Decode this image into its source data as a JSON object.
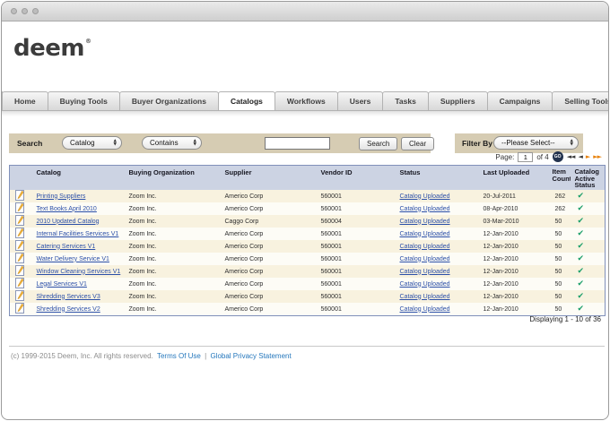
{
  "brand": {
    "logo_text": "deem",
    "trademark_mark": "®"
  },
  "nav": {
    "tabs": [
      {
        "label": "Home",
        "active": false
      },
      {
        "label": "Buying Tools",
        "active": false
      },
      {
        "label": "Buyer Organizations",
        "active": false
      },
      {
        "label": "Catalogs",
        "active": true
      },
      {
        "label": "Workflows",
        "active": false
      },
      {
        "label": "Users",
        "active": false
      },
      {
        "label": "Tasks",
        "active": false
      },
      {
        "label": "Suppliers",
        "active": false
      },
      {
        "label": "Campaigns",
        "active": false
      },
      {
        "label": "Selling Tools",
        "active": false
      }
    ]
  },
  "toolbar": {
    "search_label": "Search",
    "field_select_value": "Catalog",
    "operator_select_value": "Contains",
    "search_input_value": "",
    "search_button_label": "Search",
    "clear_button_label": "Clear",
    "filter_label": "Filter By",
    "filter_select_value": "--Please Select--"
  },
  "pagination": {
    "page_label": "Page:",
    "page_value": "1",
    "of_label": "of 4",
    "go_label": "GO",
    "first_arrow": "◄◄",
    "prev_arrow": "◄",
    "next_arrow": "►",
    "last_arrow": "►►"
  },
  "table": {
    "columns": [
      "Catalog",
      "Buying Organization",
      "Supplier",
      "Vendor ID",
      "Status",
      "Last Uploaded",
      "Item Count",
      "Catalog Active Status"
    ],
    "check_glyph": "✔",
    "rows": [
      {
        "catalog": "Printing Suppliers",
        "org": "Zoom Inc.",
        "supplier": "Americo Corp",
        "vendor_id": "560001",
        "status": "Catalog Uploaded",
        "last_uploaded": "20-Jul-2011",
        "item_count": "262",
        "active": true
      },
      {
        "catalog": "Text Books April 2010",
        "org": "Zoom Inc.",
        "supplier": "Americo Corp",
        "vendor_id": "560001",
        "status": "Catalog Uploaded",
        "last_uploaded": "08-Apr-2010",
        "item_count": "262",
        "active": true
      },
      {
        "catalog": "2010 Updated Catalog",
        "org": "Zoom Inc.",
        "supplier": "Caggo Corp",
        "vendor_id": "560004",
        "status": "Catalog Uploaded",
        "last_uploaded": "03-Mar-2010",
        "item_count": "50",
        "active": true
      },
      {
        "catalog": "Internal Facilities Services V1",
        "org": "Zoom Inc.",
        "supplier": "Americo Corp",
        "vendor_id": "560001",
        "status": "Catalog Uploaded",
        "last_uploaded": "12-Jan-2010",
        "item_count": "50",
        "active": true
      },
      {
        "catalog": "Catering Services V1",
        "org": "Zoom Inc.",
        "supplier": "Americo Corp",
        "vendor_id": "560001",
        "status": "Catalog Uploaded",
        "last_uploaded": "12-Jan-2010",
        "item_count": "50",
        "active": true
      },
      {
        "catalog": "Water Delivery Service V1",
        "org": "Zoom Inc.",
        "supplier": "Americo Corp",
        "vendor_id": "560001",
        "status": "Catalog Uploaded",
        "last_uploaded": "12-Jan-2010",
        "item_count": "50",
        "active": true
      },
      {
        "catalog": "Window Cleaning Services V1",
        "org": "Zoom Inc.",
        "supplier": "Americo Corp",
        "vendor_id": "560001",
        "status": "Catalog Uploaded",
        "last_uploaded": "12-Jan-2010",
        "item_count": "50",
        "active": true
      },
      {
        "catalog": "Legal Services V1",
        "org": "Zoom Inc.",
        "supplier": "Americo Corp",
        "vendor_id": "560001",
        "status": "Catalog Uploaded",
        "last_uploaded": "12-Jan-2010",
        "item_count": "50",
        "active": true
      },
      {
        "catalog": "Shredding Services V3",
        "org": "Zoom Inc.",
        "supplier": "Americo Corp",
        "vendor_id": "560001",
        "status": "Catalog Uploaded",
        "last_uploaded": "12-Jan-2010",
        "item_count": "50",
        "active": true
      },
      {
        "catalog": "Shredding Services V2",
        "org": "Zoom Inc.",
        "supplier": "Americo Corp",
        "vendor_id": "560001",
        "status": "Catalog Uploaded",
        "last_uploaded": "12-Jan-2010",
        "item_count": "50",
        "active": true
      }
    ],
    "displaying_text": "Displaying 1 - 10 of 36"
  },
  "footer": {
    "copyright": "(c) 1999-2015 Deem, Inc. All rights reserved.",
    "terms_link": "Terms Of Use",
    "separator": "|",
    "privacy_link": "Global Privacy Statement"
  },
  "colors": {
    "toolbar_bg": "#d6ccb3",
    "table_header_bg": "#ccd3e3",
    "row_odd_bg": "#f8f2df",
    "row_even_bg": "#fdfcf6",
    "link_blue": "#2b4fa8",
    "footer_link_blue": "#2678bd",
    "check_green": "#1a9e69",
    "pager_arrow_orange": "#e8820c",
    "go_button_bg": "#23334e"
  }
}
